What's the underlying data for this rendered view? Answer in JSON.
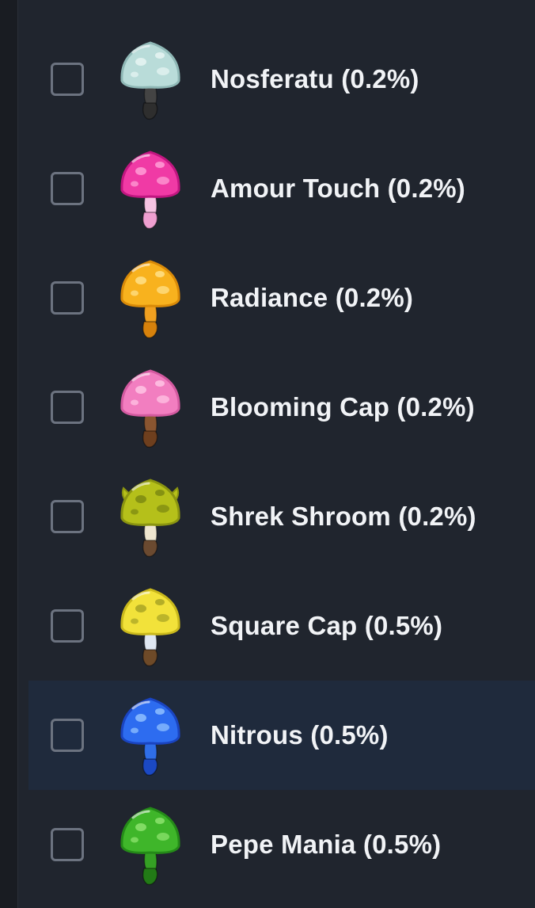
{
  "items": [
    {
      "label": "Nosferatu (0.2%)",
      "checked": false,
      "icon": "nosferatu-mushroom-icon",
      "cap_color": "#b9dcd9",
      "cap_shade": "#8fb8b6",
      "spot_color": "#e6f4f2",
      "stem_color": "#444444",
      "base_color": "#2e2e2e"
    },
    {
      "label": "Amour Touch (0.2%)",
      "checked": false,
      "icon": "amour-touch-mushroom-icon",
      "cap_color": "#f03aa5",
      "cap_shade": "#c01680",
      "spot_color": "#ff9fd6",
      "stem_color": "#f6c3e2",
      "base_color": "#ef9fd0"
    },
    {
      "label": "Radiance (0.2%)",
      "checked": false,
      "icon": "radiance-mushroom-icon",
      "cap_color": "#f8b21e",
      "cap_shade": "#d98a08",
      "spot_color": "#ffe08a",
      "stem_color": "#f0a020",
      "base_color": "#d7820c"
    },
    {
      "label": "Blooming Cap (0.2%)",
      "checked": false,
      "icon": "blooming-cap-mushroom-icon",
      "cap_color": "#f27ec0",
      "cap_shade": "#d35aa0",
      "spot_color": "#ffc4e4",
      "stem_color": "#8a5530",
      "base_color": "#6e3f1e"
    },
    {
      "label": "Shrek Shroom (0.2%)",
      "checked": false,
      "icon": "shrek-shroom-mushroom-icon",
      "cap_color": "#b5c01a",
      "cap_shade": "#8a9410",
      "spot_color": "#7d8a12",
      "stem_color": "#efe6cf",
      "base_color": "#6b4a30"
    },
    {
      "label": "Square Cap (0.5%)",
      "checked": false,
      "icon": "square-cap-mushroom-icon",
      "cap_color": "#f2e23a",
      "cap_shade": "#c9b81c",
      "spot_color": "#a9a525",
      "stem_color": "#dfe7f2",
      "base_color": "#6e4a28"
    },
    {
      "label": "Nitrous (0.5%)",
      "checked": false,
      "icon": "nitrous-mushroom-icon",
      "cap_color": "#2d6cf0",
      "cap_shade": "#1a44c0",
      "spot_color": "#8fc0ff",
      "stem_color": "#2f6ee8",
      "base_color": "#1b49c4"
    },
    {
      "label": "Pepe Mania (0.5%)",
      "checked": false,
      "icon": "pepe-mania-mushroom-icon",
      "cap_color": "#3fb62a",
      "cap_shade": "#248a18",
      "spot_color": "#8de36e",
      "stem_color": "#35a024",
      "base_color": "#227a16"
    }
  ],
  "highlighted_index": 6
}
